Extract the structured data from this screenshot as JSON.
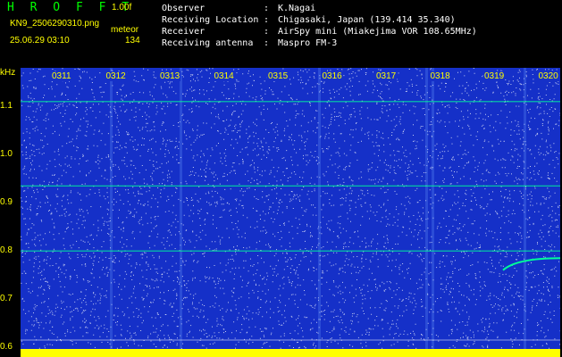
{
  "header": {
    "title": "H R O F F T",
    "version": "1.00f",
    "filename": "KN9_2506290310.png",
    "mode": "meteor",
    "datetime": "25.06.29 03:10",
    "count": "134"
  },
  "station": [
    {
      "label": "Observer",
      "value": "K.Nagai"
    },
    {
      "label": "Receiving Location",
      "value": "Chigasaki, Japan (139.414 35.340)"
    },
    {
      "label": "Receiver",
      "value": "AirSpy mini (Miakejima VOR 108.65MHz)"
    },
    {
      "label": "Receiving antenna",
      "value": "Maspro FM-3"
    }
  ],
  "colors": {
    "background": "#1530c8",
    "noise": "#ffffff",
    "trace": "#00ff99",
    "labels": "#ffff00"
  },
  "chart_data": {
    "type": "heatmap",
    "y_unit_label": "kHz",
    "y_ticks": [
      "1.1",
      "1.0",
      "0.9",
      "0.8",
      "0.7",
      "0.6"
    ],
    "y_tick_values": [
      1.1,
      1.0,
      0.9,
      0.8,
      0.7,
      0.6
    ],
    "ylim": [
      0.58,
      1.18
    ],
    "x_ticks": [
      "0311",
      "0312",
      "0313",
      "0314",
      "0315",
      "0316",
      "0317",
      "0318",
      "0319",
      "0320"
    ],
    "horizontal_lines_khz": [
      1.11,
      0.935,
      0.8
    ],
    "meteor_trace": {
      "start_time": "0320",
      "start_khz": 0.76,
      "end_khz": 0.785
    }
  }
}
